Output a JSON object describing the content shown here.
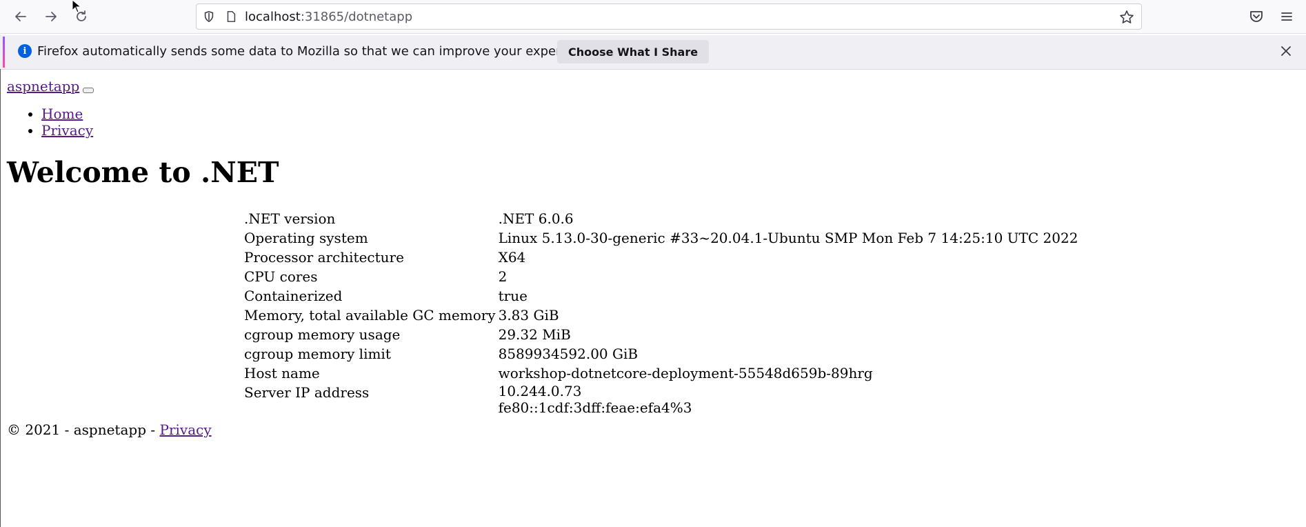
{
  "browser": {
    "url_host": "localhost",
    "url_rest": ":31865/dotnetapp",
    "icons": {
      "back": "back-arrow-icon",
      "forward": "forward-arrow-icon",
      "reload": "reload-icon",
      "shield": "tracking-shield-icon",
      "page": "page-info-icon",
      "bookmark": "star-icon",
      "pocket": "pocket-icon",
      "menu": "hamburger-menu-icon"
    }
  },
  "notification": {
    "info_glyph": "i",
    "message": "Firefox automatically sends some data to Mozilla so that we can improve your experience.",
    "button_label": "Choose What I Share"
  },
  "page": {
    "brand": "aspnetapp",
    "nav": [
      "Home",
      "Privacy"
    ],
    "heading": "Welcome to .NET",
    "rows": [
      {
        "key": ".NET version",
        "value": ".NET 6.0.6"
      },
      {
        "key": "Operating system",
        "value": "Linux 5.13.0-30-generic #33~20.04.1-Ubuntu SMP Mon Feb 7 14:25:10 UTC 2022"
      },
      {
        "key": "Processor architecture",
        "value": "X64"
      },
      {
        "key": "CPU cores",
        "value": "2"
      },
      {
        "key": "Containerized",
        "value": "true"
      },
      {
        "key": "Memory, total available GC memory",
        "value": "3.83 GiB"
      },
      {
        "key": "cgroup memory usage",
        "value": "29.32 MiB"
      },
      {
        "key": "cgroup memory limit",
        "value": "8589934592.00 GiB"
      },
      {
        "key": "Host name",
        "value": "workshop-dotnetcore-deployment-55548d659b-89hrg"
      },
      {
        "key": "Server IP address",
        "value": "10.244.0.73",
        "value2": "fe80::1cdf:3dff:feae:efa4%3"
      }
    ],
    "footer_text": "© 2021 - aspnetapp - ",
    "footer_link": "Privacy"
  },
  "colors": {
    "link_visited": "#551a8b",
    "info_blue": "#0060df"
  }
}
